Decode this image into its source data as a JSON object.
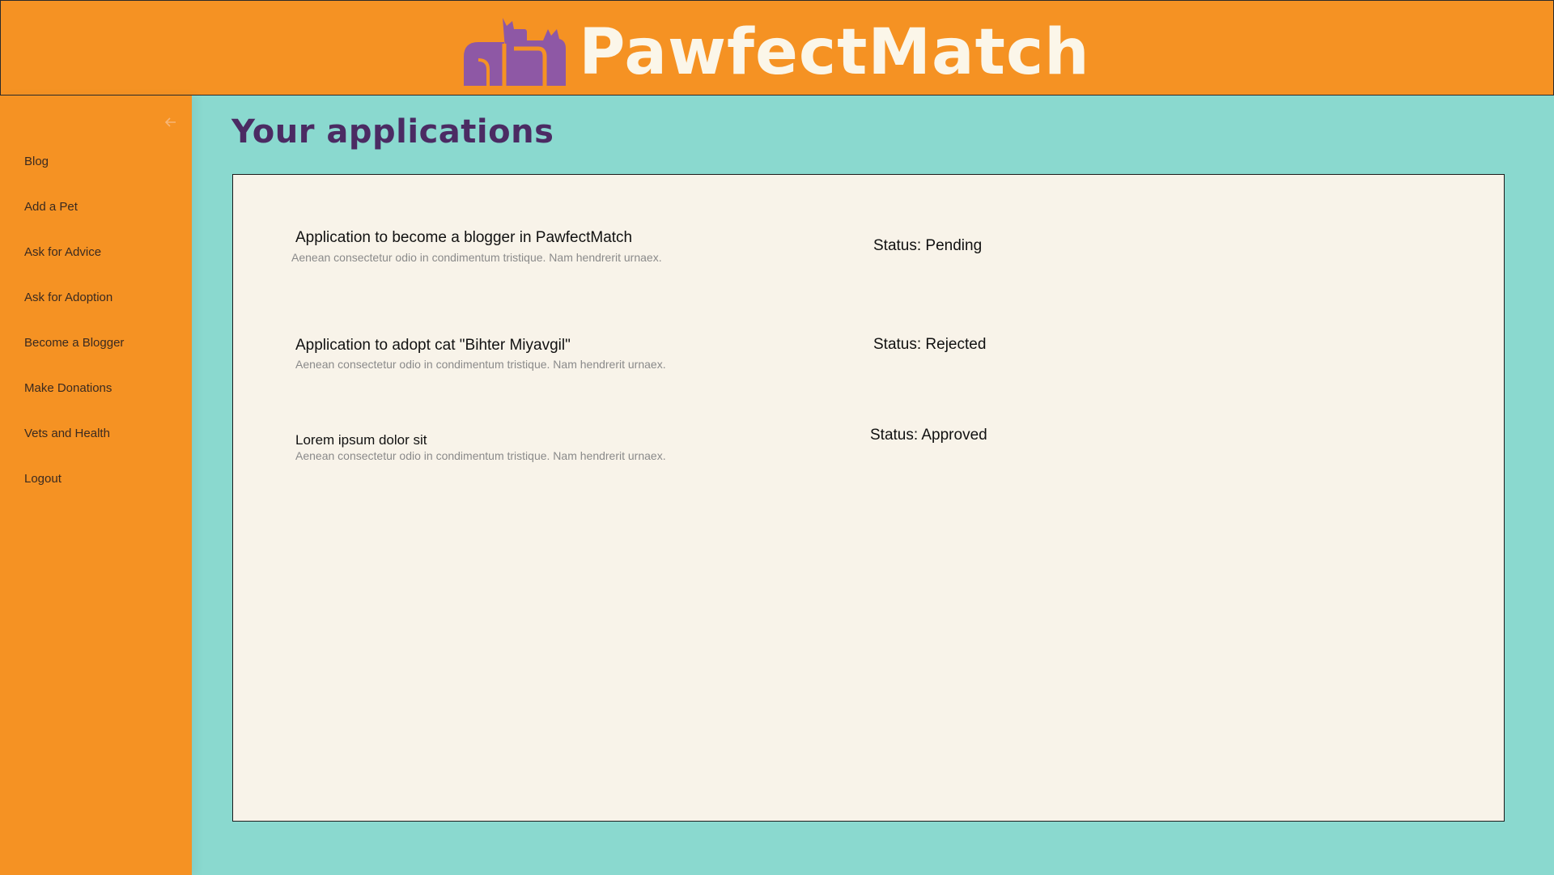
{
  "header": {
    "brand": "PawfectMatch",
    "logo_icon": "cats-logo-icon",
    "colors": {
      "background": "#f59223",
      "logo": "#8e58a5",
      "brand_text": "#fbf6e9"
    }
  },
  "sidebar": {
    "collapse_icon": "arrow-left-icon",
    "items": [
      {
        "label": "Blog"
      },
      {
        "label": "Add a Pet"
      },
      {
        "label": "Ask for Advice"
      },
      {
        "label": "Ask for Adoption"
      },
      {
        "label": "Become a Blogger"
      },
      {
        "label": "Make Donations"
      },
      {
        "label": "Vets and Health"
      },
      {
        "label": "Logout"
      }
    ]
  },
  "main": {
    "title": "Your applications",
    "colors": {
      "background": "#8ad9cf",
      "title": "#4b2b63",
      "panel": "#f8f3e9"
    },
    "applications": [
      {
        "title": "Application to become a blogger in PawfectMatch",
        "description": "Aenean consectetur odio in condimentum tristique. Nam hendrerit urnaex.",
        "status": "Status: Pending"
      },
      {
        "title": "Application to adopt cat \"Bihter Miyavgil\"",
        "description": "Aenean consectetur odio in condimentum tristique. Nam hendrerit urnaex.",
        "status": "Status: Rejected"
      },
      {
        "title": "Lorem ipsum dolor sit",
        "description": "Aenean consectetur odio in condimentum tristique. Nam hendrerit urnaex.",
        "status": "Status: Approved"
      }
    ]
  }
}
